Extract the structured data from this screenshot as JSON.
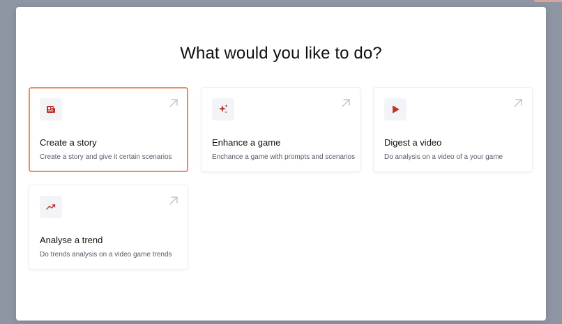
{
  "modal": {
    "title": "What would you like to do?"
  },
  "colors": {
    "accent_border": "#ec8d5a",
    "icon_red": "#c0332b",
    "icon_bg": "#f2f4f8"
  },
  "cards": [
    {
      "title": "Create a story",
      "description": "Create a story and give it certain scenarios",
      "icon": "newspaper-icon",
      "selected": true
    },
    {
      "title": "Enhance a game",
      "description": "Enchance a game with prompts and scenarios",
      "icon": "sparkles-icon",
      "selected": false
    },
    {
      "title": "Digest a video",
      "description": "Do analysis on a video of a your game",
      "icon": "play-icon",
      "selected": false
    },
    {
      "title": "Analyse a trend",
      "description": "Do trends analysis on a video game trends",
      "icon": "trend-up-icon",
      "selected": false
    }
  ]
}
